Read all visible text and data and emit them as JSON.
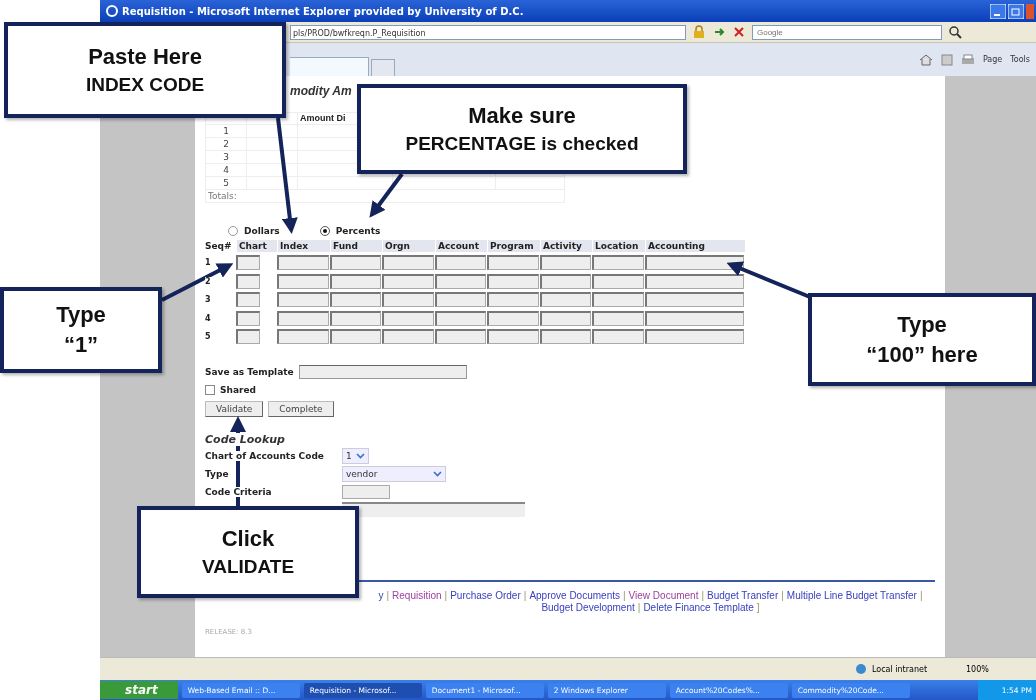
{
  "window": {
    "title": "Requisition - Microsoft Internet Explorer provided by University of D.C."
  },
  "address_bar": {
    "url": "pls/PROD/bwfkreqn.P_Requisition",
    "search_placeholder": "Google"
  },
  "command_bar": {
    "items": [
      "Page",
      "Tools"
    ]
  },
  "page": {
    "heading_fragment": "modity Am",
    "summary_table": {
      "header_fragment": "Amount Di",
      "rows": [
        "1",
        "2",
        "3",
        "4",
        "5"
      ],
      "totals_label": "Totals:"
    },
    "amount_type": [
      {
        "label": "Dollars",
        "selected": false
      },
      {
        "label": "Percents",
        "selected": true
      }
    ],
    "accounting": {
      "columns": [
        "Seq#",
        "Chart",
        "Index",
        "Fund",
        "Orgn",
        "Account",
        "Program",
        "Activity",
        "Location",
        "Accounting"
      ],
      "rows": [
        "1",
        "2",
        "3",
        "4",
        "5"
      ]
    },
    "save_template": {
      "label": "Save as Template"
    },
    "shared": {
      "label": "Shared",
      "checked": false
    },
    "buttons": [
      "Validate",
      "Complete"
    ],
    "code_lookup": {
      "title": "Code Lookup",
      "fields": [
        {
          "kind": "select",
          "label": "Chart of Accounts Code",
          "value": "1"
        },
        {
          "kind": "select",
          "label": "Type",
          "value": "vendor"
        },
        {
          "kind": "input",
          "label": "Code Criteria"
        }
      ]
    },
    "links": [
      "y",
      "Requisition",
      "Purchase Order",
      "Approve Documents",
      "View Document",
      "Budget Transfer",
      "Multiple Line Budget Transfer",
      "Budget Development",
      "Delete Finance Template"
    ],
    "links_separator": "|",
    "links_end": "]",
    "release": "RELEASE: 8.3"
  },
  "status_bar": {
    "zone": "Local intranet",
    "zoom": "100%"
  },
  "taskbar": {
    "start": "start",
    "tasks": [
      {
        "label": "Web-Based Email :: D...",
        "selected": false
      },
      {
        "label": "Requisition - Microsof...",
        "selected": true
      },
      {
        "label": "Document1 - Microsof...",
        "selected": false
      },
      {
        "label": "2 Windows Explorer",
        "selected": false
      },
      {
        "label": "Account%20Codes%...",
        "selected": false
      },
      {
        "label": "Commodity%20Code...",
        "selected": false
      }
    ],
    "clock": "1:54 PM"
  },
  "callouts": [
    {
      "lines": [
        "Paste Here",
        "INDEX CODE"
      ]
    },
    {
      "lines": [
        "Make sure",
        "PERCENTAGE is checked"
      ]
    },
    {
      "lines": [
        "Type",
        "“1”"
      ]
    },
    {
      "lines": [
        "Type",
        "“100” here"
      ]
    },
    {
      "lines": [
        "Click",
        "VALIDATE"
      ]
    }
  ]
}
